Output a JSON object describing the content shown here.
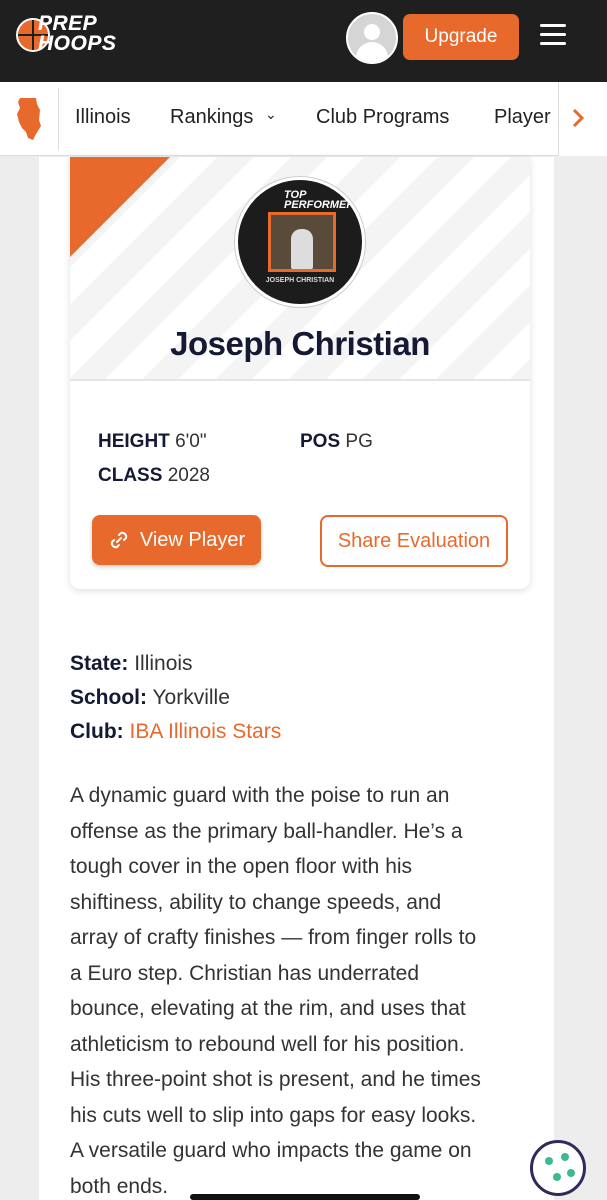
{
  "header": {
    "logo_line1": "PREP",
    "logo_line2": "HOOPS",
    "upgrade_label": "Upgrade"
  },
  "nav": {
    "items": [
      "Illinois",
      "Rankings",
      "Club Programs",
      "Player"
    ],
    "rankings_caret": "⌄"
  },
  "player": {
    "photo_badge": "TOP PERFORMER",
    "photo_caption": "JOSEPH CHRISTIAN",
    "name": "Joseph Christian",
    "height_label": "HEIGHT",
    "height_value": "6'0\"",
    "pos_label": "POS",
    "pos_value": "PG",
    "class_label": "CLASS",
    "class_value": "2028",
    "view_button": "View Player",
    "share_button": "Share Evaluation"
  },
  "info": {
    "state_label": "State:",
    "state_value": "Illinois",
    "school_label": "School:",
    "school_value": "Yorkville",
    "club_label": "Club:",
    "club_value": "IBA Illinois Stars"
  },
  "evaluation": {
    "lines": [
      "A dynamic guard with the poise to run an",
      "offense as the primary ball-handler. He’s a",
      "tough cover in the open floor with his",
      "shiftiness, ability to change speeds, and",
      "array of crafty finishes — from finger rolls to",
      "a Euro step. Christian has underrated",
      "bounce, elevating at the rim, and uses that",
      "athleticism to rebound well for his position.",
      "His three-point shot is present, and he times",
      "his cuts well to slip into gaps for easy looks.",
      "A versatile guard who impacts the game on",
      "both ends."
    ]
  },
  "colors": {
    "brand_orange": "#e8692c",
    "header_dark": "#1f1f1f",
    "name_navy": "#141a33"
  }
}
